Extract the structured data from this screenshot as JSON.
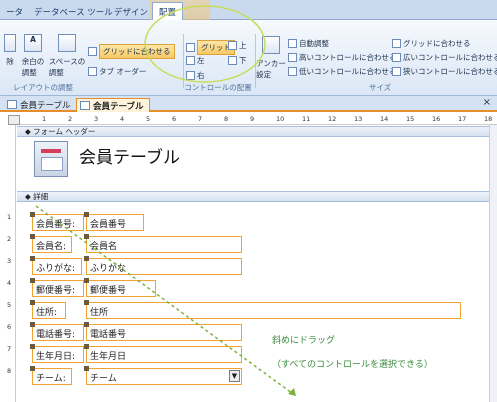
{
  "ribbon_tabs": [
    "ータ",
    "データベース ツール",
    "デザイン",
    "配置"
  ],
  "ribbon": {
    "left_icon_label": "除",
    "group1_label": "レイアウトの調整",
    "margin_btn": "余白の\n調整",
    "spacing_btn": "スペースの\n調整",
    "snap_grid": "グリッドに合わせる",
    "tab_order": "タブ オーダー",
    "grid": "グリッド",
    "align_top": "上",
    "align_bottom": "下",
    "align_right": "右",
    "group2_label": "コントロールの配置",
    "anchor": "アンカー\n設定",
    "autosize": "自動調整",
    "to_tallest": "高いコントロールに合わせる",
    "to_shortest": "低いコントロールに合わせる",
    "to_grid": "グリッドに合わせる",
    "to_widest": "広いコントロールに合わせる",
    "to_narrowest": "狭いコントロールに合わせる",
    "group3_label": "サイズ"
  },
  "doc_tabs": [
    "会員テーブル",
    "会員テーブル"
  ],
  "ruler_marks": [
    "1",
    "2",
    "3",
    "4",
    "5",
    "6",
    "7",
    "8",
    "9",
    "10",
    "11",
    "12",
    "13",
    "14",
    "15",
    "16",
    "17",
    "18"
  ],
  "sections": {
    "form_header": "フォーム ヘッダー",
    "detail": "詳細"
  },
  "form_title": "会員テーブル",
  "fields": [
    {
      "label": "会員番号:",
      "value": "会員番号"
    },
    {
      "label": "会員名:",
      "value": "会員名"
    },
    {
      "label": "ふりがな:",
      "value": "ふりがな"
    },
    {
      "label": "郵便番号:",
      "value": "郵便番号"
    },
    {
      "label": "住所:",
      "value": "住所"
    },
    {
      "label": "電話番号:",
      "value": "電話番号"
    },
    {
      "label": "生年月日:",
      "value": "生年月日"
    },
    {
      "label": "チーム:",
      "value": "チーム"
    }
  ],
  "annotation": {
    "line1": "斜めにドラッグ",
    "line2": "（すべてのコントロールを選択できる）"
  },
  "colors": {
    "selection": "#f0a331",
    "annotation": "#3a8a3a"
  }
}
